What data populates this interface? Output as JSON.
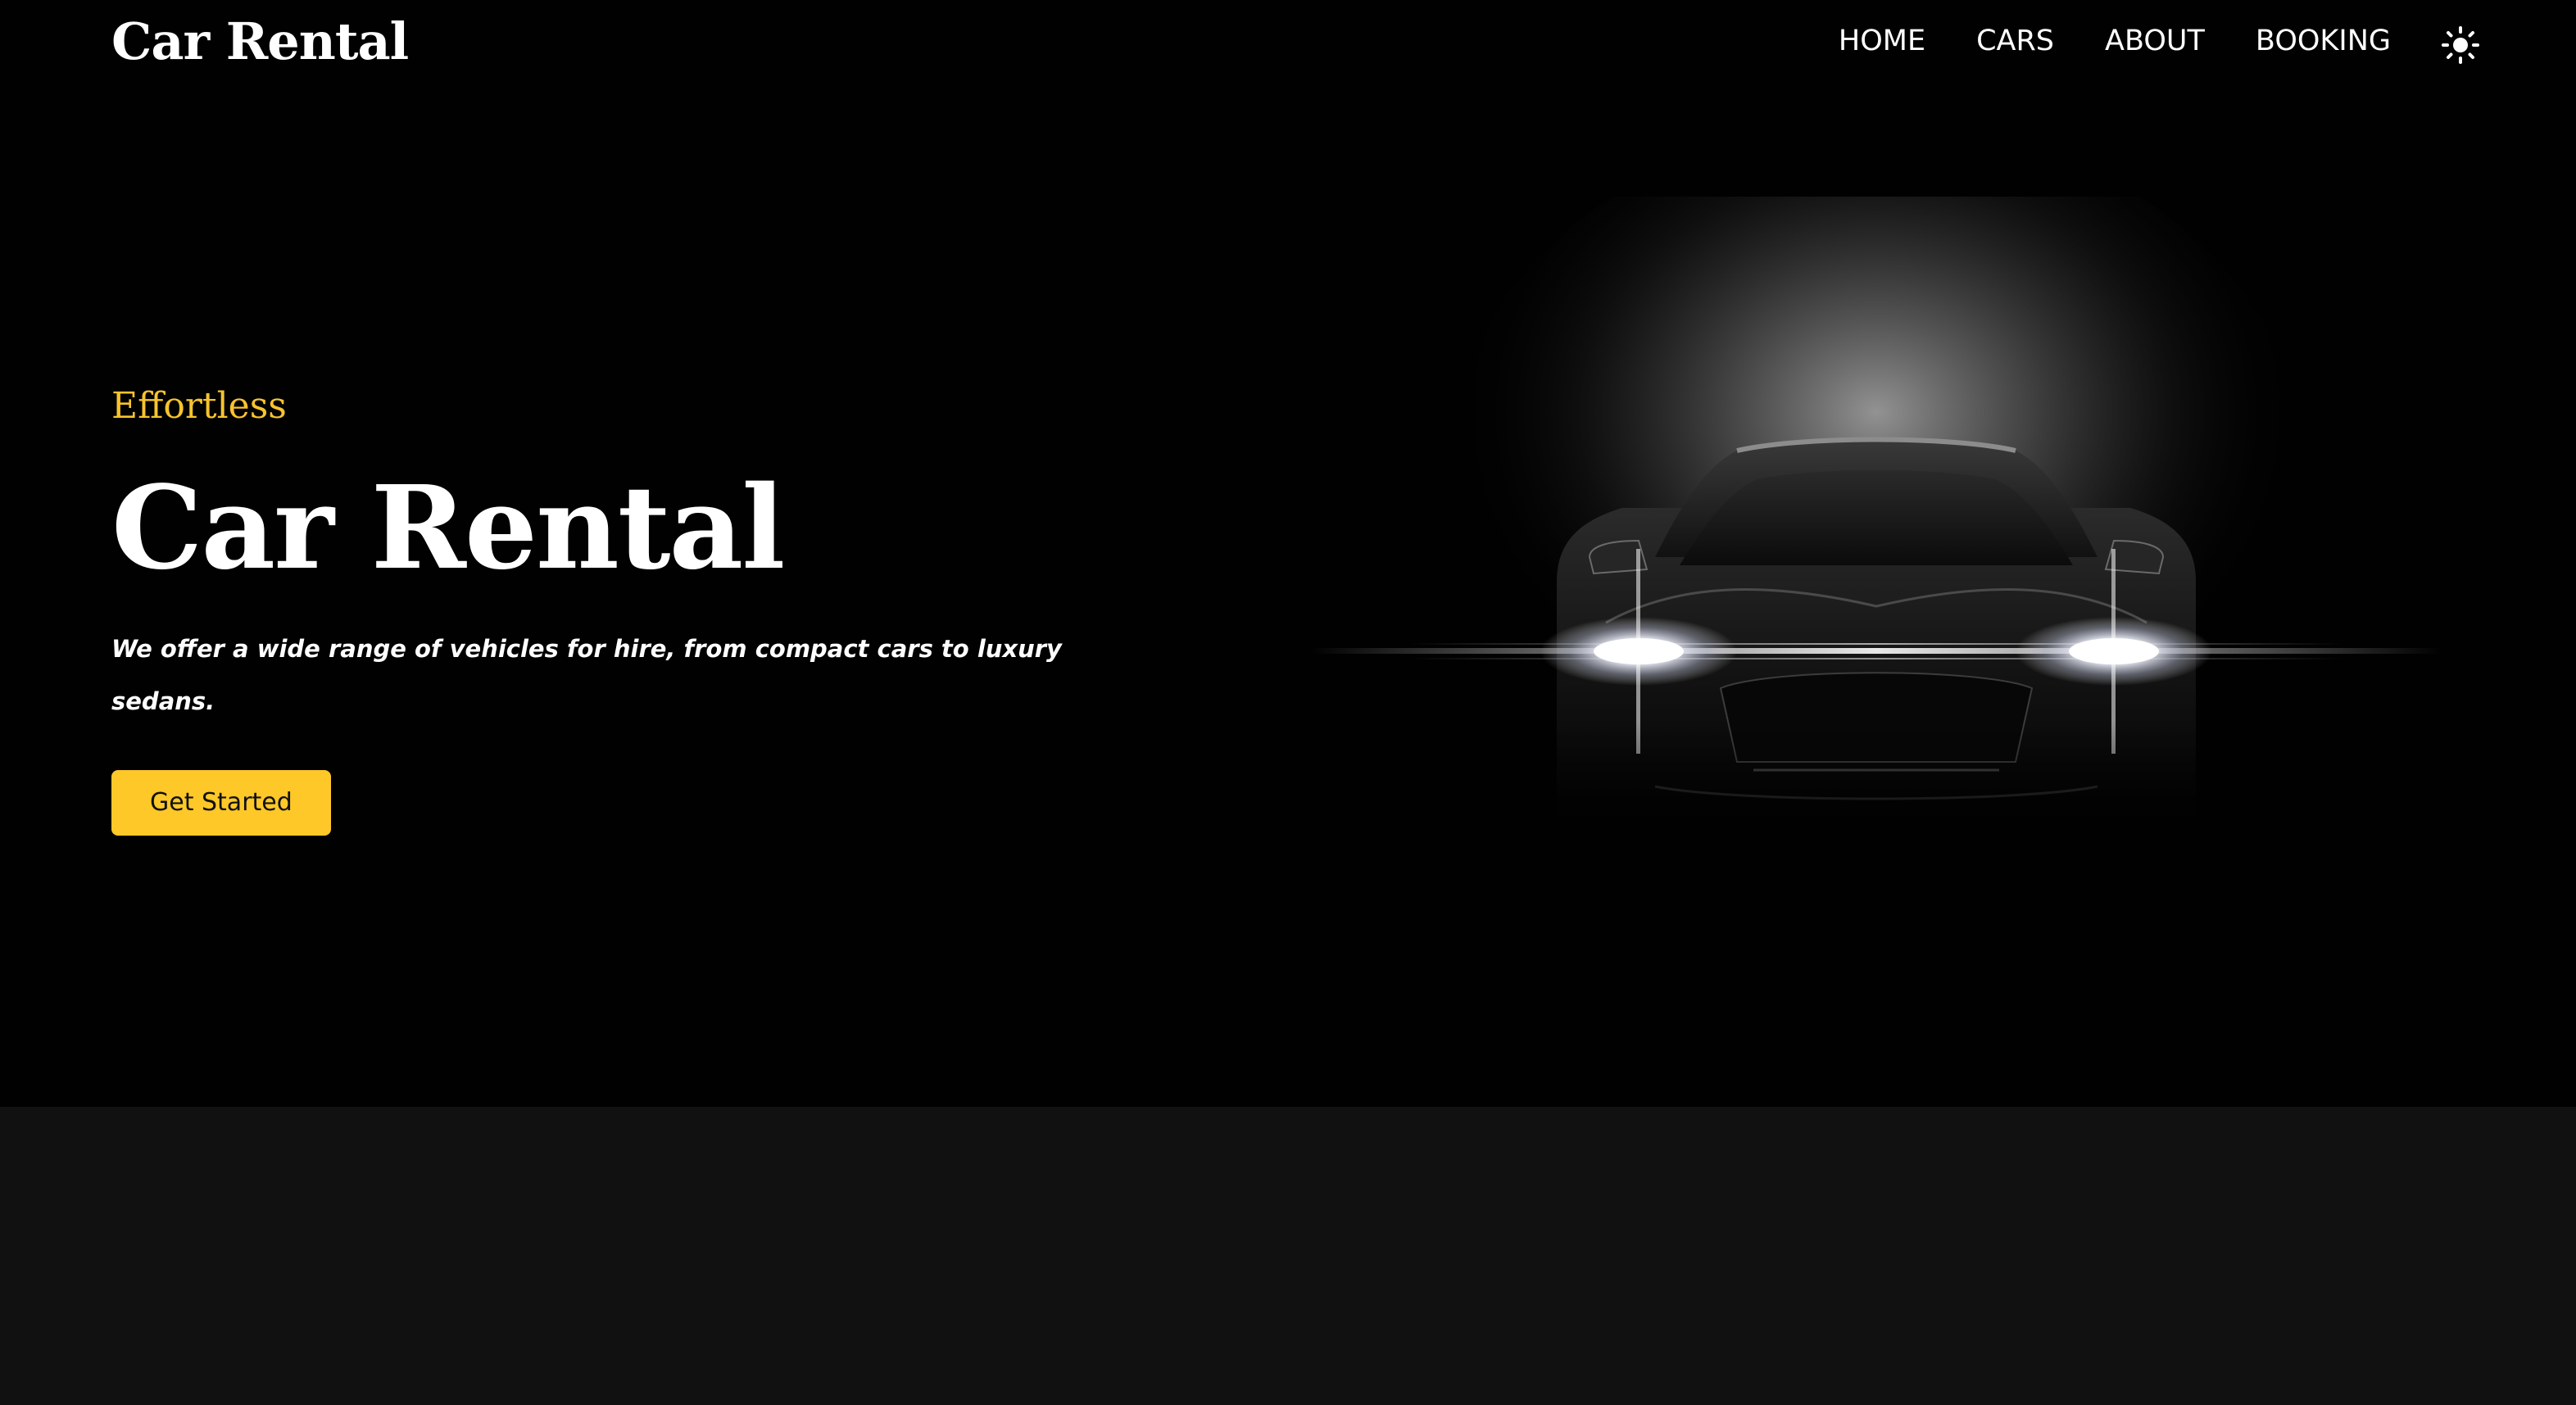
{
  "brand": {
    "name": "Car Rental"
  },
  "nav": {
    "items": [
      {
        "label": "HOME"
      },
      {
        "label": "CARS"
      },
      {
        "label": "ABOUT"
      },
      {
        "label": "BOOKING"
      }
    ],
    "theme_toggle_icon": "sun-icon"
  },
  "hero": {
    "eyebrow": "Effortless",
    "title": "Car Rental",
    "description": "We offer a wide range of vehicles for hire, from compact cars to luxury sedans.",
    "cta_label": "Get Started",
    "image_icon": "car-headlights-image"
  },
  "colors": {
    "accent": "#fdc828",
    "eyebrow": "#f7c32e",
    "hero_bg": "#010102",
    "lower_bg": "#111111",
    "text": "#ffffff"
  }
}
